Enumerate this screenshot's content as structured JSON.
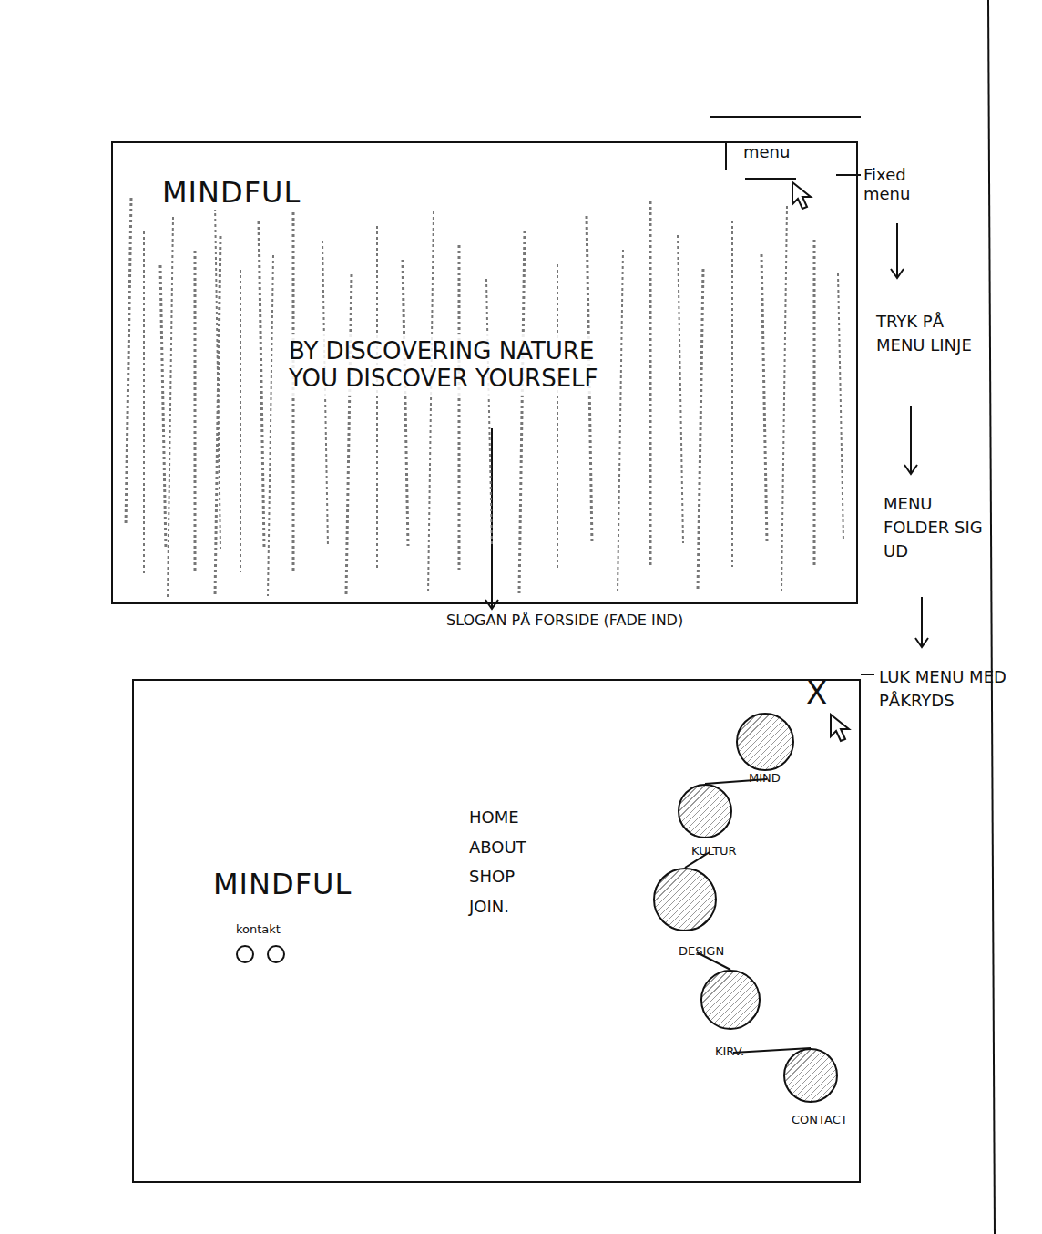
{
  "home": {
    "logo": "MINDFUL",
    "menu_label": "menu",
    "slogan": [
      "BY DISCOVERING NATURE",
      "YOU DISCOVER YOURSELF"
    ]
  },
  "menu_open": {
    "logo": "MINDFUL",
    "contact_label": "kontakt",
    "close": "X",
    "links": [
      "HOME",
      "ABOUT",
      "SHOP",
      "JOIN."
    ],
    "bubbles": [
      {
        "label": "MIND"
      },
      {
        "label": "KULTUR"
      },
      {
        "label": "DESIGN"
      },
      {
        "label": "KIRV."
      },
      {
        "label": "CONTACT"
      }
    ]
  },
  "annotations": {
    "fixed_menu": "Fixed menu",
    "steps": [
      "TRYK PÅ MENU LINJE",
      "MENU FOLDER SIG UD",
      "LUK MENU MED PÅKRYDS"
    ],
    "slogan_note": "SLOGAN PÅ FORSIDE (FADE IND)"
  }
}
